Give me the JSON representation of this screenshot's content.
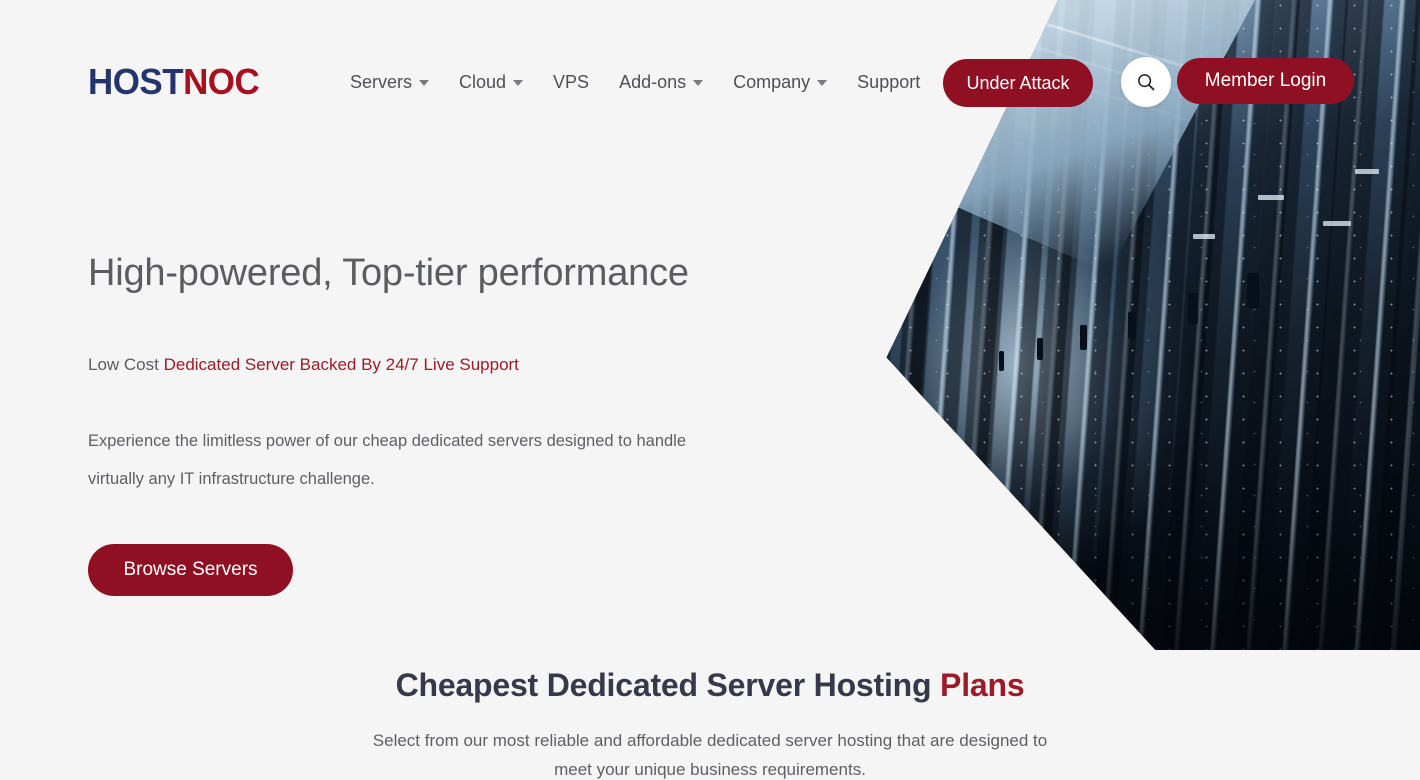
{
  "site": {
    "background_color": "#f5f5f5",
    "brand_red": "#8f1022",
    "brand_navy": "#24356e"
  },
  "header": {
    "logo": {
      "part1": "HOST",
      "part2": "NOC",
      "part1_color": "#24356e",
      "part2_color": "#a6101f"
    },
    "nav": [
      {
        "label": "Servers",
        "has_dropdown": true
      },
      {
        "label": "Cloud",
        "has_dropdown": true
      },
      {
        "label": "VPS",
        "has_dropdown": false
      },
      {
        "label": "Add-ons",
        "has_dropdown": true
      },
      {
        "label": "Company",
        "has_dropdown": true
      },
      {
        "label": "Support",
        "has_dropdown": false
      }
    ],
    "under_attack_label": "Under Attack",
    "search_icon": "search-icon",
    "member_login_label": "Member Login"
  },
  "hero": {
    "title": "High-powered, Top-tier performance",
    "subtitle_plain": "Low Cost ",
    "subtitle_accent": "Dedicated Server Backed By 24/7 Live Support",
    "paragraph": "Experience the limitless power of our cheap dedicated servers designed to handle virtually any IT infrastructure challenge.",
    "cta_label": "Browse Servers",
    "image_alt": "data-center-server-racks"
  },
  "plans": {
    "title_plain": "Cheapest Dedicated Server Hosting ",
    "title_accent": "Plans",
    "subtitle": "Select from our most reliable and affordable dedicated server hosting that are designed to meet your unique business requirements."
  }
}
